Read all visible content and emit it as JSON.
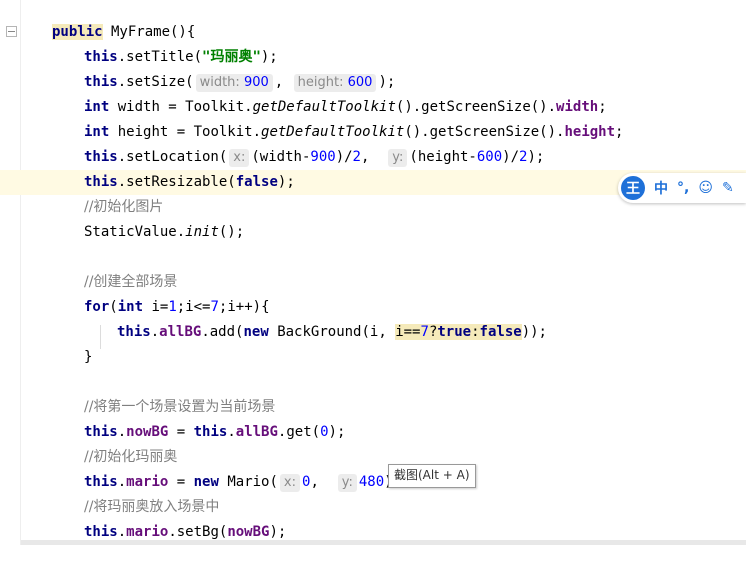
{
  "editor": {
    "lines": {
      "l1": {
        "kw": "public",
        "rest": " MyFrame(){"
      },
      "l2": {
        "this": "this",
        "a": ".setTitle(",
        "str": "\"玛丽奥\"",
        "b": ");"
      },
      "l3": {
        "this": "this",
        "a": ".setSize(",
        "hint1": "width:",
        "v1": "900",
        "c1": ",",
        "hint2": "height:",
        "v2": "600",
        "b": ");"
      },
      "l4": {
        "kw": "int",
        "a": " width = Toolkit.",
        "it": "getDefaultToolkit",
        "b": "().getScreenSize().",
        "fld": "width",
        "c": ";"
      },
      "l5": {
        "kw": "int",
        "a": " height = Toolkit.",
        "it": "getDefaultToolkit",
        "b": "().getScreenSize().",
        "fld": "height",
        "c": ";"
      },
      "l6": {
        "this": "this",
        "a": ".setLocation(",
        "hint1": "x:",
        "b": "(width-",
        "n1": "900",
        "c": ")/",
        "n2": "2",
        "d": ",",
        "hint2": "y:",
        "e": "(height-",
        "n3": "600",
        "f": ")/",
        "n4": "2",
        "g": ");"
      },
      "l7": {
        "this": "this",
        "a": ".setResizable(",
        "kw": "false",
        "b": ");"
      },
      "l8": {
        "cm": "//初始化图片"
      },
      "l9": {
        "a": "StaticValue.",
        "it": "init",
        "b": "();"
      },
      "l11": {
        "cm": "//创建全部场景"
      },
      "l12": {
        "kw1": "for",
        "a": "(",
        "kw2": "int",
        "b": " i=",
        "n1": "1",
        "c": ";i<=",
        "n2": "7",
        "d": ";i++){"
      },
      "l13": {
        "this": "this",
        "a": ".",
        "fld": "allBG",
        "b": ".add(",
        "kw": "new",
        "c": " BackGround(i, ",
        "e1": "i==",
        "n": "7",
        "e2": "?",
        "t": "true",
        "e3": ":",
        "f": "false",
        "g": "));"
      },
      "l14": {
        "a": "}"
      },
      "l16": {
        "cm": "//将第一个场景设置为当前场景"
      },
      "l17": {
        "this1": "this",
        "a": ".",
        "fld1": "nowBG",
        "b": " = ",
        "this2": "this",
        "c": ".",
        "fld2": "allBG",
        "d": ".get(",
        "n": "0",
        "e": ");"
      },
      "l18": {
        "cm": "//初始化玛丽奥"
      },
      "l19": {
        "this": "this",
        "a": ".",
        "fld": "mario",
        "b": " = ",
        "kw": "new",
        "c": " Mario(",
        "hint1": "x:",
        "n1": "0",
        "d": ",",
        "hint2": "y:",
        "n2": "480",
        "e": ");"
      },
      "l20": {
        "cm": "//将玛丽奥放入场景中"
      },
      "l21": {
        "this": "this",
        "a": ".",
        "fld1": "mario",
        "b": ".setBg(",
        "fld2": "nowBG",
        "c": ");"
      }
    }
  },
  "tooltip": {
    "text": "截图(Alt + A)"
  },
  "ime": {
    "logo": "王",
    "mode": "中",
    "punct": "°,",
    "emoji": "☺",
    "pen": "✎"
  },
  "colors": {
    "keyword": "#000080",
    "field": "#660e7a",
    "number": "#0000ff",
    "string": "#008000",
    "comment": "#808080",
    "current_line": "#fffae3"
  }
}
